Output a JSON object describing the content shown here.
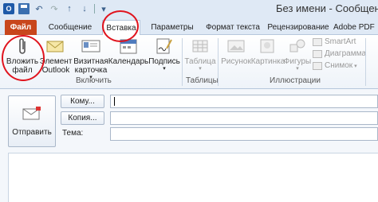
{
  "window": {
    "title": "Без имени - Сообщение"
  },
  "quick_access": {
    "icons": [
      "outlook-logo",
      "save-icon",
      "undo-icon",
      "redo-icon",
      "up-arrow-icon",
      "down-arrow-icon",
      "customize-icon"
    ]
  },
  "tabs": [
    {
      "label": "Файл"
    },
    {
      "label": "Сообщение"
    },
    {
      "label": "Вставка"
    },
    {
      "label": "Параметры"
    },
    {
      "label": "Формат текста"
    },
    {
      "label": "Рецензирование"
    },
    {
      "label": "Adobe PDF"
    }
  ],
  "ribbon": {
    "include_group": {
      "label": "Включить",
      "attach_file": "Вложить\nфайл",
      "outlook_item": "Элемент\nOutlook",
      "business_card": "Визитная\nкарточка",
      "calendar": "Календарь",
      "signature": "Подпись"
    },
    "tables_group": {
      "label": "Таблицы",
      "table": "Таблица"
    },
    "illustrations_group": {
      "label": "Иллюстрации",
      "picture": "Рисунок",
      "clip_art": "Картинка",
      "shapes": "Фигуры",
      "smartart": "SmartArt",
      "chart": "Диаграмма",
      "screenshot": "Снимок"
    }
  },
  "compose": {
    "send": "Отправить",
    "to": "Кому...",
    "cc": "Копия...",
    "subject": "Тема:"
  },
  "colors": {
    "file_tab": "#c8461c",
    "annotation": "#e0141e",
    "accent": "#1e5aa8"
  }
}
